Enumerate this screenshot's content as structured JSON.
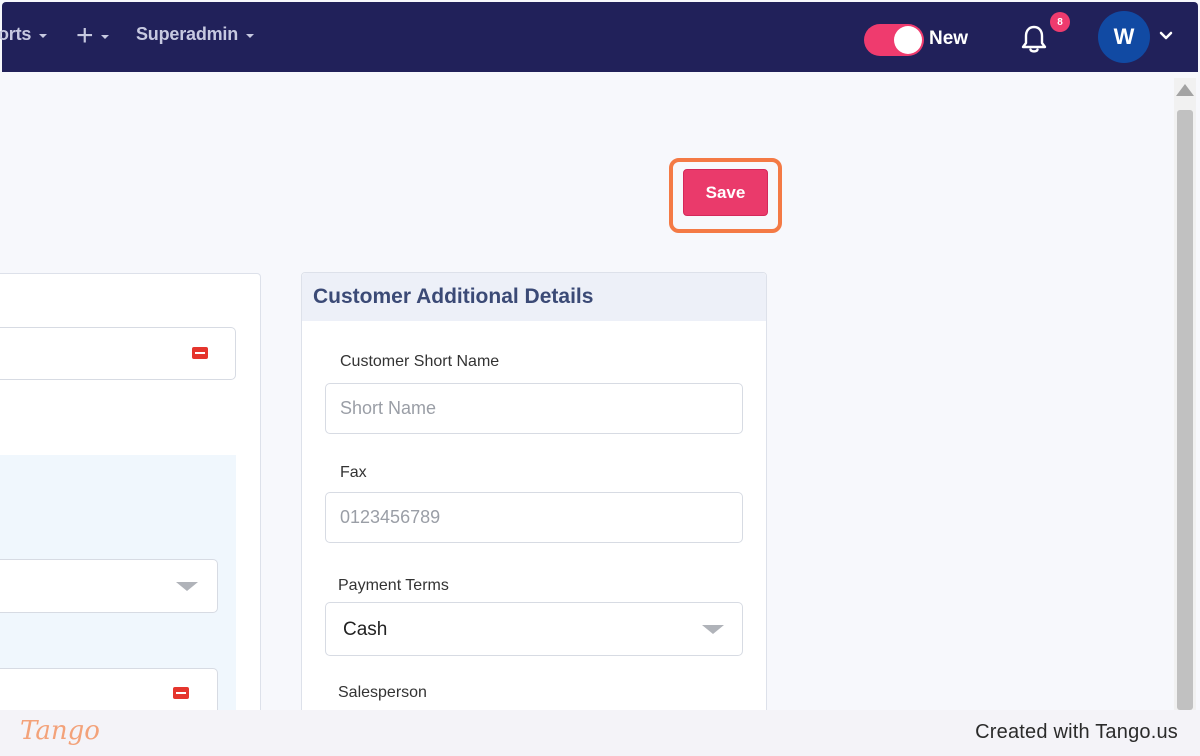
{
  "topnav": {
    "items": [
      {
        "label": "orts"
      },
      {
        "label": ""
      },
      {
        "label": "Superadmin"
      }
    ],
    "toggle_label": "New",
    "notification_count": "8",
    "avatar_initial": "W",
    "colors": {
      "bar": "#21215a",
      "accent": "#ef3b6e",
      "avatar": "#114aa3"
    }
  },
  "actions": {
    "save_label": "Save",
    "save_color": "#ea3a6b",
    "highlight_color": "#f47a45"
  },
  "additional_details": {
    "title": "Customer Additional Details",
    "short_name": {
      "label": "Customer Short Name",
      "placeholder": "Short Name",
      "value": ""
    },
    "fax": {
      "label": "Fax",
      "placeholder": "0123456789",
      "value": ""
    },
    "payment_terms": {
      "label": "Payment Terms",
      "selected": "Cash"
    },
    "salesperson": {
      "label": "Salesperson"
    }
  },
  "footer": {
    "brand": "Tango",
    "credit": "Created with Tango.us"
  }
}
